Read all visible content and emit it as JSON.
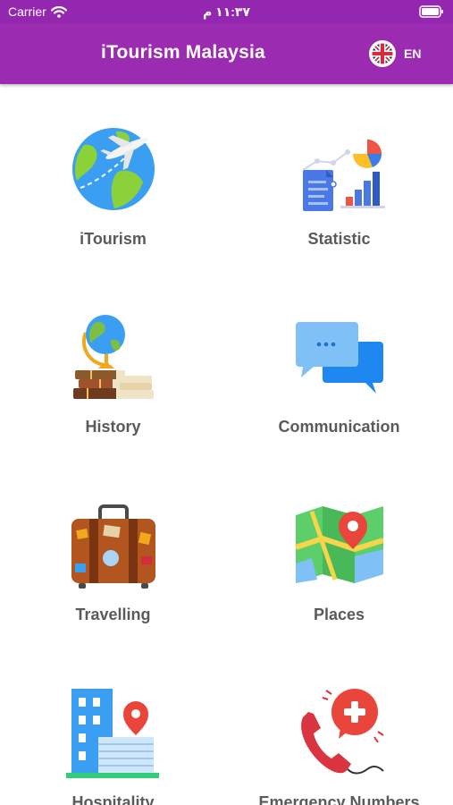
{
  "status_bar": {
    "carrier": "Carrier",
    "time": "١١:٣٧ م"
  },
  "app_bar": {
    "title": "iTourism Malaysia",
    "language_code": "EN"
  },
  "menu": [
    {
      "label": "iTourism",
      "icon": "globe-airplane-icon"
    },
    {
      "label": "Statistic",
      "icon": "statistics-chart-icon"
    },
    {
      "label": "History",
      "icon": "globe-books-icon"
    },
    {
      "label": "Communication",
      "icon": "chat-bubbles-icon"
    },
    {
      "label": "Travelling",
      "icon": "suitcase-icon"
    },
    {
      "label": "Places",
      "icon": "map-pin-icon"
    },
    {
      "label": "Hospitality",
      "icon": "hotel-location-icon"
    },
    {
      "label": "Emergency Numbers",
      "icon": "emergency-phone-icon"
    }
  ],
  "colors": {
    "app_bar": "#9b2cb2",
    "label_text": "#5a5a5a"
  }
}
